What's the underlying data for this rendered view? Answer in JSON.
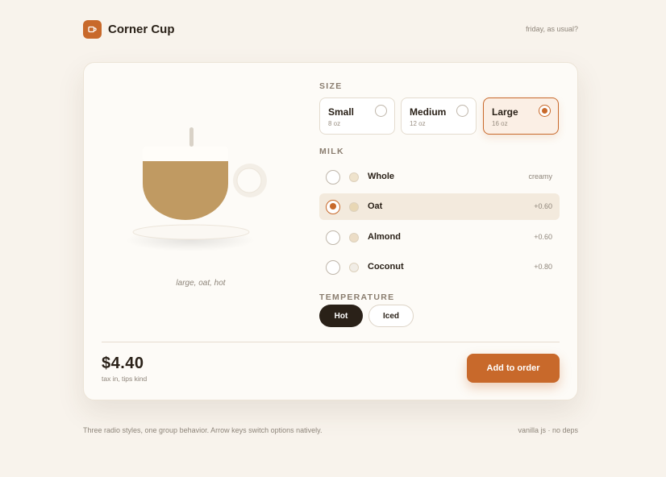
{
  "header": {
    "brand": "Corner Cup",
    "tagline": "friday, as usual?",
    "logo_icon": "cup-icon"
  },
  "preview": {
    "caption": "large, oat, hot",
    "coffee_color": "#c09a62"
  },
  "size": {
    "label": "SIZE",
    "options": [
      {
        "name": "Small",
        "sub": "8 oz",
        "selected": false
      },
      {
        "name": "Medium",
        "sub": "12 oz",
        "selected": false
      },
      {
        "name": "Large",
        "sub": "16 oz",
        "selected": true
      }
    ]
  },
  "milk": {
    "label": "MILK",
    "options": [
      {
        "name": "Whole",
        "note": "creamy",
        "swatch": "#efe3cc",
        "selected": false
      },
      {
        "name": "Oat",
        "note": "+0.60",
        "swatch": "#e8d7b4",
        "selected": true
      },
      {
        "name": "Almond",
        "note": "+0.60",
        "swatch": "#ecddc6",
        "selected": false
      },
      {
        "name": "Coconut",
        "note": "+0.80",
        "swatch": "#f1ede6",
        "selected": false
      }
    ]
  },
  "temperature": {
    "label": "TEMPERATURE",
    "hot_label": "Hot",
    "iced_label": "Iced",
    "selected": "Hot"
  },
  "summary": {
    "price": "$4.40",
    "price_sub": "tax in, tips kind",
    "add_button": "Add to order"
  },
  "footer": {
    "left": "Three radio styles, one group behavior. Arrow keys switch options natively.",
    "right": "vanilla js · no deps"
  },
  "colors": {
    "accent": "#c8692b",
    "dark": "#2a2118",
    "background": "#f8f3ec"
  }
}
